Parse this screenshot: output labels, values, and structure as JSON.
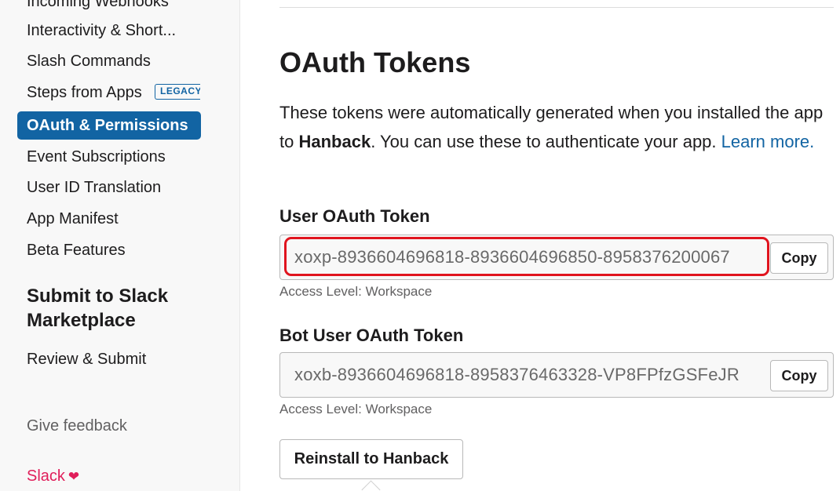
{
  "sidebar": {
    "items": [
      {
        "label": "Incoming Webhooks"
      },
      {
        "label": "Interactivity & Short..."
      },
      {
        "label": "Slash Commands"
      },
      {
        "label": "Steps from Apps",
        "badge": "LEGACY"
      },
      {
        "label": "OAuth & Permissions",
        "active": true
      },
      {
        "label": "Event Subscriptions"
      },
      {
        "label": "User ID Translation"
      },
      {
        "label": "App Manifest"
      },
      {
        "label": "Beta Features"
      }
    ],
    "submit_section": {
      "heading": "Submit to Slack Marketplace",
      "items": [
        {
          "label": "Review & Submit"
        }
      ]
    },
    "feedback_label": "Give feedback",
    "footer_label": "Slack",
    "footer_icon": "heart-icon"
  },
  "main": {
    "title": "OAuth Tokens",
    "description": {
      "part1": "These tokens were automatically generated when you installed the app to ",
      "app_name": "Hanback",
      "part2": ". You can use these to authenticate your app. ",
      "link_text": "Learn more."
    },
    "user_token": {
      "label": "User OAuth Token",
      "value": "xoxp-8936604696818-8936604696850-8958376200067",
      "copy_label": "Copy",
      "access_level": "Access Level: Workspace"
    },
    "bot_token": {
      "label": "Bot User OAuth Token",
      "value": "xoxb-8936604696818-8958376463328-VP8FPfzGSFeJR",
      "copy_label": "Copy",
      "access_level": "Access Level: Workspace"
    },
    "reinstall_label": "Reinstall to Hanback"
  },
  "colors": {
    "accent": "#1264a3",
    "highlight": "#e0141e",
    "slack_pink": "#e01e5a"
  }
}
